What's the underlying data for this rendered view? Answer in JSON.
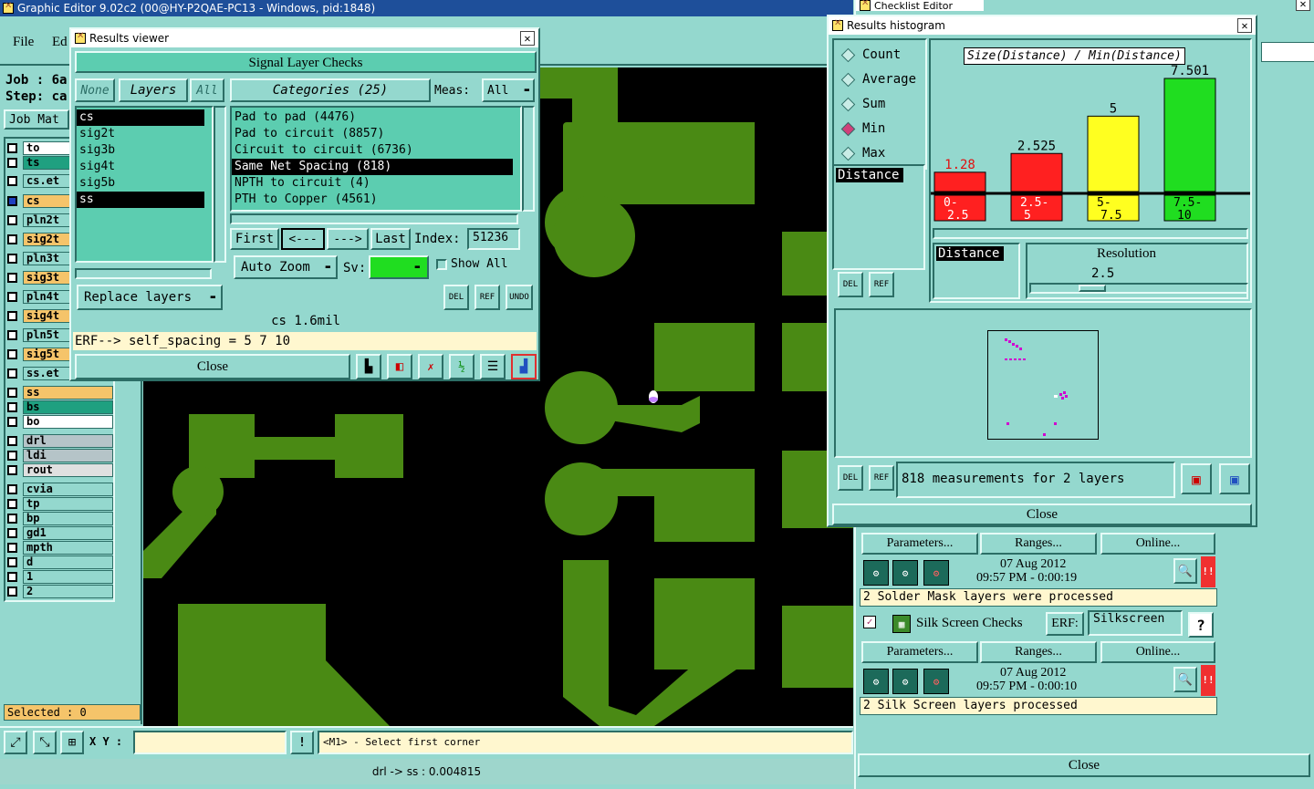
{
  "main": {
    "title": "Graphic Editor 9.02c2 (00@HY-P2QAE-PC13 - Windows, pid:1848)",
    "menu": [
      "File",
      "Ed"
    ],
    "job_label": "Job : 6a",
    "step_label": "Step: ca",
    "job_matrix_btn": "Job Mat",
    "selected_text": "Selected : 0",
    "xy_label": "X Y :",
    "prompt": "<M1> - Select first corner",
    "status_bottom": "drl -> ss : 0.004815",
    "layers": [
      {
        "name": "to",
        "color": "#ffffff"
      },
      {
        "name": "ts",
        "color": "#1fa080"
      },
      {
        "name": "cs.et",
        "color": "#94d8ce"
      },
      {
        "name": "cs",
        "color": "#f5c46a"
      },
      {
        "name": "pln2t",
        "color": "#94d8ce"
      },
      {
        "name": "sig2t",
        "color": "#f5c46a"
      },
      {
        "name": "pln3t",
        "color": "#94d8ce"
      },
      {
        "name": "sig3t",
        "color": "#f5c46a"
      },
      {
        "name": "pln4t",
        "color": "#94d8ce"
      },
      {
        "name": "sig4t",
        "color": "#f5c46a"
      },
      {
        "name": "pln5t",
        "color": "#94d8ce"
      },
      {
        "name": "sig5t",
        "color": "#f5c46a"
      },
      {
        "name": "ss.et",
        "color": "#94d8ce"
      },
      {
        "name": "ss",
        "color": "#f5c46a"
      },
      {
        "name": "bs",
        "color": "#1fa080"
      },
      {
        "name": "bo",
        "color": "#ffffff"
      },
      {
        "name": "drl",
        "color": "#b5c4c8"
      },
      {
        "name": "ldi",
        "color": "#b5c4c8"
      },
      {
        "name": "rout",
        "color": "#e0e0e0"
      },
      {
        "name": "cvia",
        "color": "#94d8ce"
      },
      {
        "name": "tp",
        "color": "#94d8ce"
      },
      {
        "name": "bp",
        "color": "#94d8ce"
      },
      {
        "name": "gd1",
        "color": "#94d8ce"
      },
      {
        "name": "mpth",
        "color": "#94d8ce"
      },
      {
        "name": "d",
        "color": "#94d8ce"
      },
      {
        "name": "1",
        "color": "#94d8ce"
      },
      {
        "name": "2",
        "color": "#94d8ce"
      }
    ]
  },
  "results_viewer": {
    "title": "Results viewer",
    "header": "Signal Layer Checks",
    "none_btn": "None",
    "layers_btn": "Layers",
    "all_btn": "All",
    "categories_btn": "Categories (25)",
    "meas_label": "Meas:",
    "meas_value": "All",
    "layers_list": [
      "cs",
      "sig2t",
      "sig3b",
      "sig4t",
      "sig5b",
      "ss"
    ],
    "categories": [
      "Pad to pad (4476)",
      "Pad to circuit (8857)",
      "Circuit to circuit (6736)",
      "Same Net Spacing (818)",
      "NPTH to circuit (4)",
      "PTH to Copper (4561)"
    ],
    "first_btn": "First",
    "prev_btn": "<---",
    "next_btn": "--->",
    "last_btn": "Last",
    "index_label": "Index:",
    "index_value": "51236",
    "auto_zoom": "Auto Zoom",
    "sv_label": "Sv:",
    "show_all": "Show All",
    "replace_layers": "Replace layers",
    "del": "DEL",
    "ref": "REF",
    "undo": "UNDO",
    "info": "cs 1.6mil",
    "erf": "ERF--> self_spacing = 5 7 10",
    "close": "Close"
  },
  "histogram": {
    "title": "Results histogram",
    "options": [
      "Count",
      "Average",
      "Sum",
      "Min",
      "Max"
    ],
    "selected_option": "Min",
    "chart_title": "Size(Distance) / Min(Distance)",
    "distance_label": "Distance",
    "resolution_label": "Resolution",
    "resolution_value": "2.5",
    "del": "DEL",
    "ref": "REF",
    "measurements": "818 measurements for 2 layers",
    "close": "Close"
  },
  "chart_data": {
    "type": "bar",
    "title": "Size(Distance) / Min(Distance)",
    "categories": [
      "0-2.5",
      "2.5-5",
      "5-7.5",
      "7.5-10"
    ],
    "values": [
      1.28,
      2.525,
      5,
      7.501
    ],
    "value_labels": [
      "1.28",
      "2.525",
      "5",
      "7.501"
    ],
    "category_labels": [
      [
        "0-",
        "2.5"
      ],
      [
        "2.5-",
        "5"
      ],
      [
        "5-",
        "7.5"
      ],
      [
        "7.5-",
        "10"
      ]
    ],
    "colors": [
      "#ff2020",
      "#ff2020",
      "#ffff20",
      "#20dd20"
    ],
    "ylim": [
      0,
      7.501
    ]
  },
  "checklist": {
    "title": "Checklist Editor",
    "parameters_btn": "Parameters...",
    "ranges_btn": "Ranges...",
    "online_btn": "Online...",
    "row1_date": "07 Aug 2012",
    "row1_time": "09:57 PM - 0:00:19",
    "row1_status": "2 Solder Mask layers were processed",
    "silk_label": "Silk Screen Checks",
    "erf_label": "ERF:",
    "erf_value": "Silkscreen",
    "help": "?",
    "row2_date": "07 Aug 2012",
    "row2_time": "09:57 PM - 0:00:10",
    "row2_status": "2 Silk Screen layers processed",
    "close": "Close",
    "alert": "!!"
  }
}
